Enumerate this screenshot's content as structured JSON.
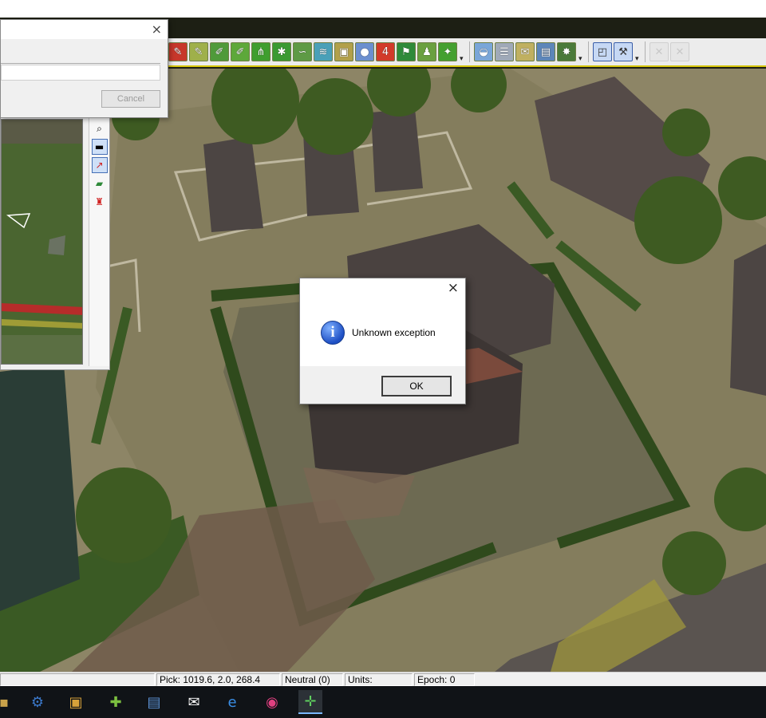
{
  "window": {
    "status_pick": "Pick: 1019.6, 2.0, 268.4",
    "status_player": "Neutral (0)",
    "status_units": "Units:",
    "status_epoch": "Epoch: 0"
  },
  "progress_dialog": {
    "close_glyph": "×",
    "cancel_label": "Cancel"
  },
  "message_box": {
    "close_glyph": "×",
    "icon_glyph": "i",
    "message": "Unknown exception",
    "ok_label": "OK"
  },
  "toolbar": {
    "buttons": [
      {
        "icon": "brush-red-icon",
        "glyph": "✎",
        "color": "#c7372b"
      },
      {
        "icon": "brush-yellow-icon",
        "glyph": "✎",
        "color": "#9fb04a"
      },
      {
        "icon": "paint-brush-icon",
        "glyph": "✐",
        "color": "#4f9a3a"
      },
      {
        "icon": "paint-green-icon",
        "glyph": "✐",
        "color": "#5da83a"
      },
      {
        "icon": "grass-icon",
        "glyph": "⋔",
        "color": "#3f9e2f"
      },
      {
        "icon": "tree-plant-icon",
        "glyph": "✱",
        "color": "#3a9a32"
      },
      {
        "icon": "road-icon",
        "glyph": "∽",
        "color": "#5e9a45"
      },
      {
        "icon": "river-icon",
        "glyph": "≋",
        "color": "#4aa0b8"
      },
      {
        "icon": "vehicle-icon",
        "glyph": "▣",
        "color": "#b2a04a"
      },
      {
        "icon": "objects-icon",
        "glyph": "●",
        "color": "#6b8fcf"
      },
      {
        "icon": "unit-4-icon",
        "glyph": "4",
        "color": "#d23a2a"
      },
      {
        "icon": "flag-icon",
        "glyph": "⚑",
        "color": "#2f8a3a"
      },
      {
        "icon": "soldiers-icon",
        "glyph": "♟",
        "color": "#6aa040"
      },
      {
        "icon": "brush-dot-icon",
        "glyph": "✦",
        "color": "#44a030"
      },
      {
        "icon": "landscape-icon",
        "glyph": "◒",
        "color": "#7aa6d8"
      },
      {
        "icon": "checklist-icon",
        "glyph": "☰",
        "color": "#9fa9b8"
      },
      {
        "icon": "script-icon",
        "glyph": "✉",
        "color": "#c0b060"
      },
      {
        "icon": "sign-icon",
        "glyph": "▤",
        "color": "#5d86b9"
      },
      {
        "icon": "bug-icon",
        "glyph": "✸",
        "color": "#4a7a3a"
      },
      {
        "icon": "map-tool-icon",
        "glyph": "◰",
        "color": "#c09b3a"
      },
      {
        "icon": "tools-icon",
        "glyph": "⚒",
        "color": "#c7d8f0"
      },
      {
        "icon": "delete-icon",
        "glyph": "✕",
        "color": "#e0e0e0"
      },
      {
        "icon": "delete-all-icon",
        "glyph": "✕",
        "color": "#e0e0e0"
      }
    ]
  },
  "minimap_tools": [
    {
      "icon": "zoom-icon",
      "glyph": "⌕"
    },
    {
      "icon": "tank-icon",
      "glyph": "▬"
    },
    {
      "icon": "arrow-icon",
      "glyph": "↗"
    },
    {
      "icon": "layers-icon",
      "glyph": "▰"
    },
    {
      "icon": "red-unit-icon",
      "glyph": "♜"
    }
  ],
  "taskbar": [
    {
      "icon": "app-icon",
      "glyph": "▪"
    },
    {
      "icon": "settings-app-icon",
      "glyph": "⚙"
    },
    {
      "icon": "photo-app-icon",
      "glyph": "▣"
    },
    {
      "icon": "plus-app-icon",
      "glyph": "✚"
    },
    {
      "icon": "book-app-icon",
      "glyph": "▤"
    },
    {
      "icon": "mail-icon",
      "glyph": "✉"
    },
    {
      "icon": "edge-icon",
      "glyph": "e"
    },
    {
      "icon": "paint3d-icon",
      "glyph": "◉"
    },
    {
      "icon": "game-editor-icon",
      "glyph": "✛"
    }
  ],
  "colors": {
    "ground": "#8d8566",
    "hedge": "#2f4a1c",
    "roof": "#4a3e3c",
    "accent": "#d4c400"
  }
}
